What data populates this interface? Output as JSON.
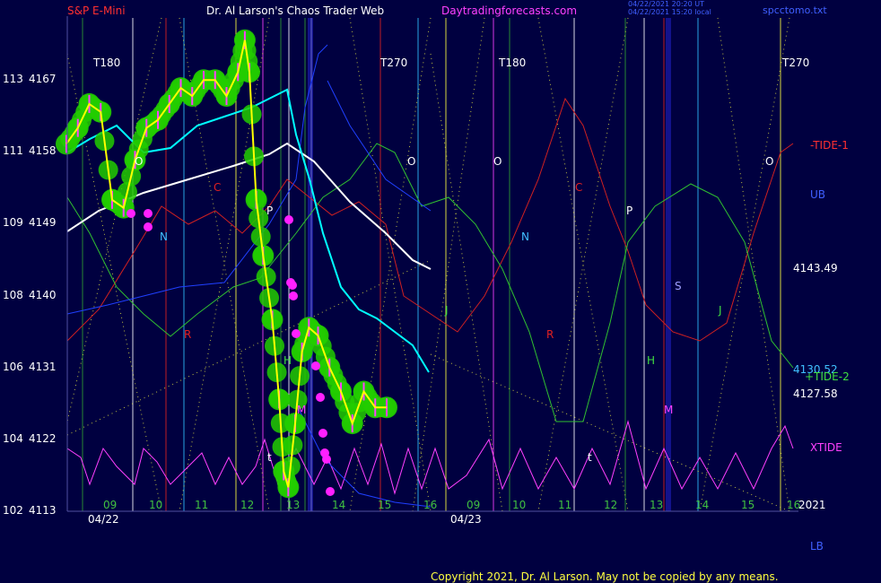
{
  "header": {
    "symbol": "S&P E-Mini",
    "title": "Dr. Al Larson's Chaos Trader Web",
    "site": "Daytradingforecasts.com",
    "stamp1": "04/22/2021 20:20 UT",
    "stamp2": "04/22/2021 15:20 local",
    "file": "spcctomo.txt"
  },
  "footer": {
    "copyright": "Copyright 2021, Dr. Al Larson. May not be copied by any means."
  },
  "y_axis": {
    "labels": [
      {
        "esc": "113",
        "price": "4167"
      },
      {
        "esc": "111",
        "price": "4158"
      },
      {
        "esc": "109",
        "price": "4149"
      },
      {
        "esc": "108",
        "price": "4140"
      },
      {
        "esc": "106",
        "price": "4131"
      },
      {
        "esc": "104",
        "price": "4122"
      },
      {
        "esc": "102",
        "price": "4113"
      }
    ]
  },
  "x_axis": {
    "hours_day1": [
      "09",
      "10",
      "11",
      "12",
      "13",
      "14",
      "15",
      "16"
    ],
    "hours_day2": [
      "09",
      "10",
      "11",
      "12",
      "13",
      "14",
      "15",
      "16"
    ],
    "date1": "04/22",
    "date2": "04/23",
    "year": "2021"
  },
  "right_labels": {
    "tide1": "-TIDE-1",
    "ub": "UB",
    "last_price": "4143.49",
    "val1": "4130.52",
    "tide2": "+TIDE-2",
    "val2": "4127.58",
    "xtide": "XTIDE",
    "lb": "LB"
  },
  "markers": {
    "t180": "T180",
    "t270": "T270",
    "letters": [
      "O",
      "C",
      "N",
      "P",
      "R",
      "H",
      "M",
      "t",
      "S",
      "J"
    ]
  },
  "colors": {
    "background": "#000040",
    "price": "#ffff00",
    "candle_glow": "#22cc00",
    "tide1": "#d02020",
    "tide2": "#30c030",
    "xtide": "#ff40ff",
    "ub_lb": "#2040ff",
    "ema_fast": "#00ffff",
    "ema_slow": "#ffffff"
  },
  "chart_data": {
    "type": "line",
    "title": "S&P E-Mini",
    "ylabel": "",
    "ylim": [
      4113,
      4175
    ],
    "series": [
      {
        "name": "price",
        "x": [
          9.0,
          9.25,
          9.5,
          9.75,
          10.0,
          10.25,
          10.5,
          10.75,
          11.0,
          11.25,
          11.5,
          11.75,
          12.0,
          12.25,
          12.5,
          12.75,
          12.9,
          13.0,
          13.15,
          13.3,
          13.5,
          13.65,
          13.75,
          13.85,
          14.0,
          14.15,
          14.3,
          14.5,
          14.75,
          15.0,
          15.25,
          15.5,
          15.75,
          16.0
        ],
        "values": [
          4159,
          4161,
          4164,
          4163,
          4152,
          4151,
          4157,
          4161,
          4162,
          4164,
          4166,
          4165,
          4167,
          4167,
          4165,
          4168,
          4172,
          4168,
          4152,
          4145,
          4137,
          4127,
          4118,
          4116,
          4124,
          4133,
          4136,
          4135,
          4131,
          4128,
          4124,
          4128,
          4126,
          4126
        ]
      }
    ]
  }
}
